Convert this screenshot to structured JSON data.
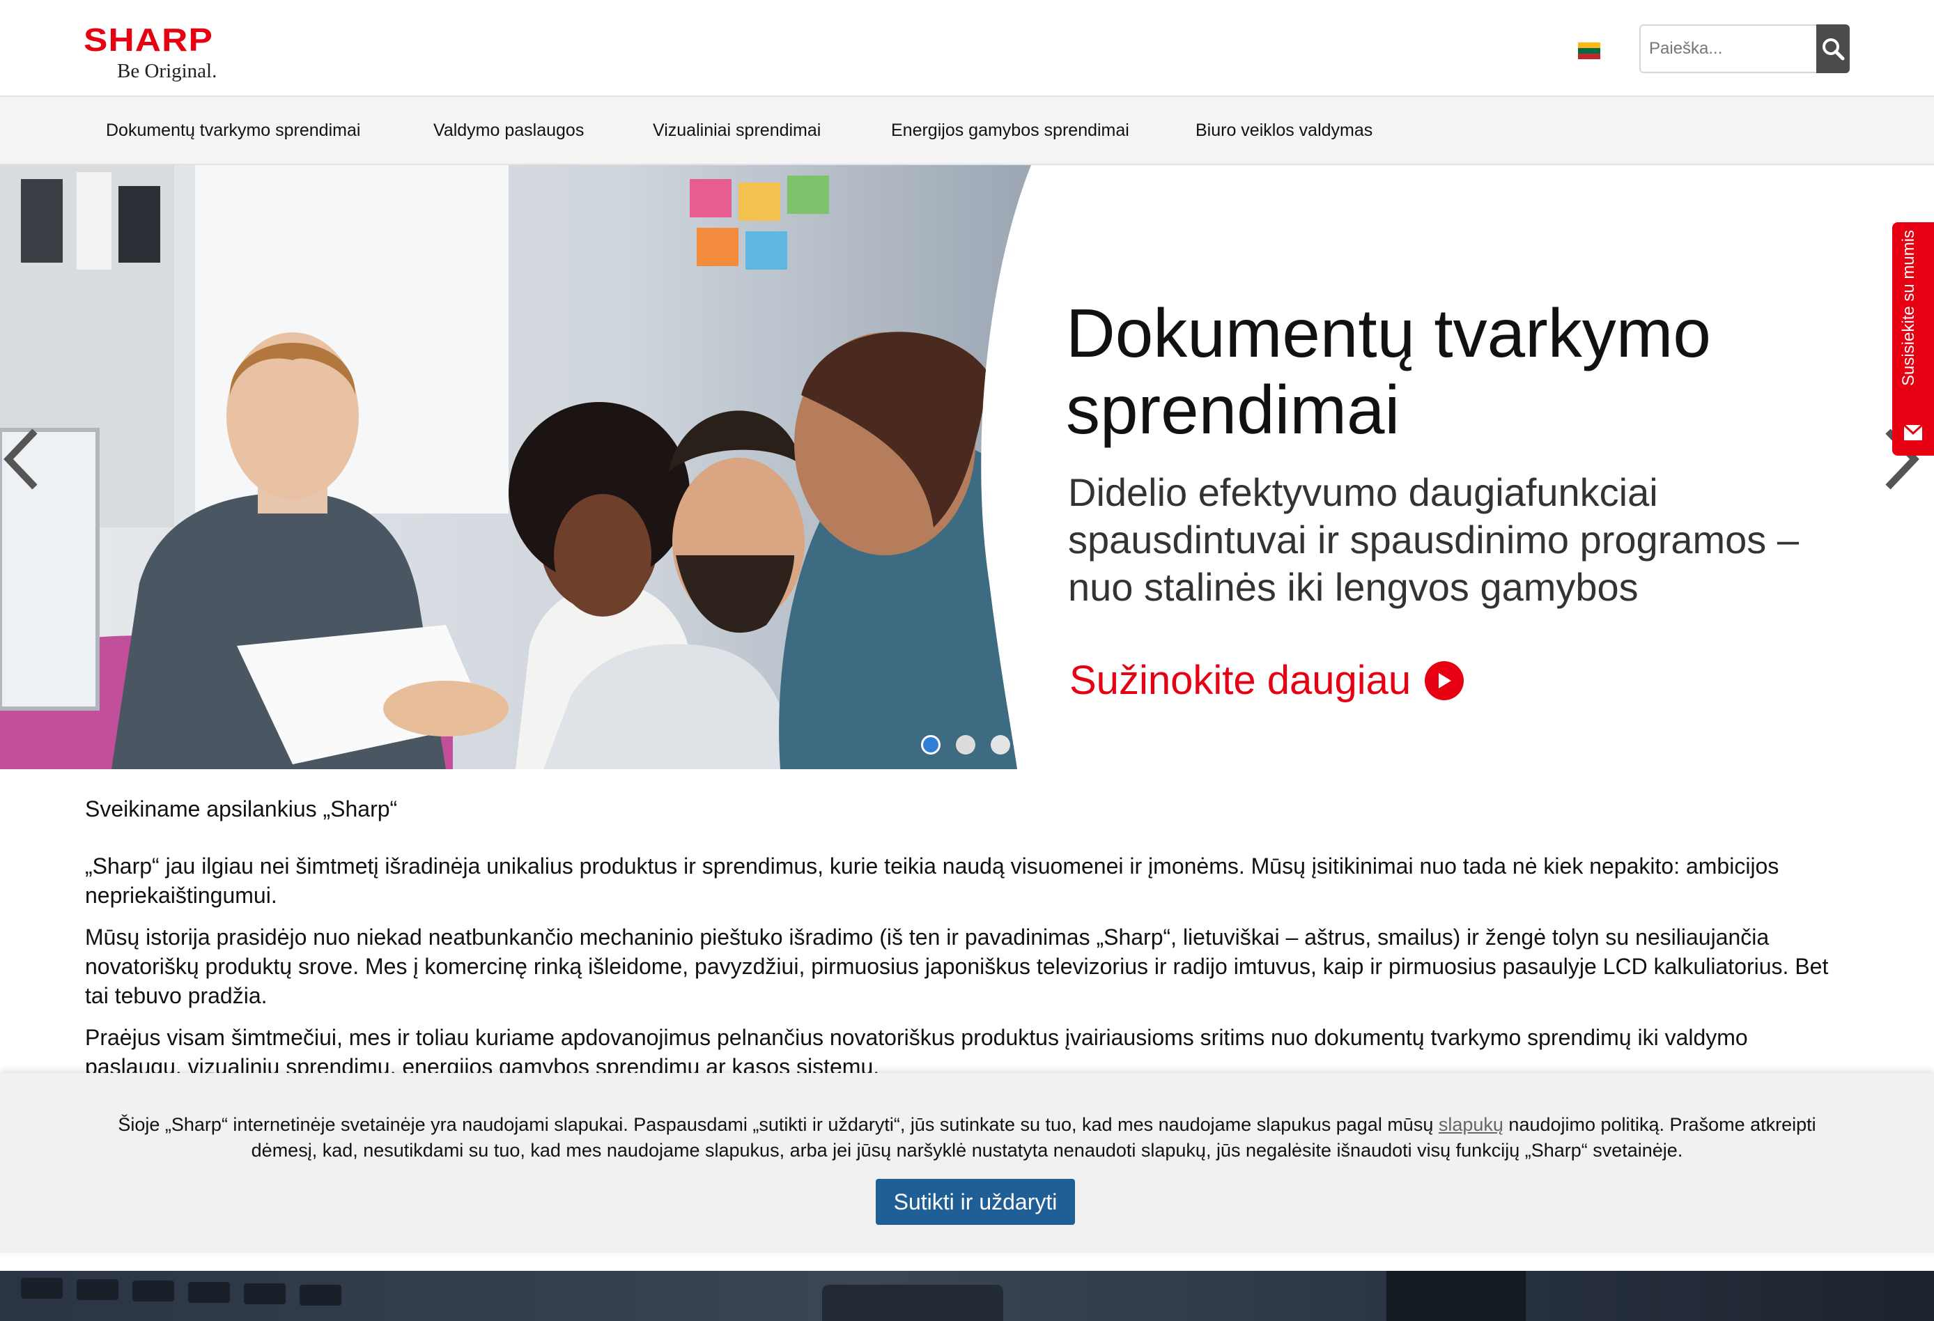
{
  "header": {
    "logo_word": "SHARP",
    "logo_tagline": "Be Original.",
    "language_flag": "lithuania-flag-icon",
    "search": {
      "placeholder": "Paieška...",
      "button_icon": "search-icon"
    }
  },
  "nav": {
    "items": [
      {
        "label": "Dokumentų tvarkymo sprendimai"
      },
      {
        "label": "Valdymo paslaugos"
      },
      {
        "label": "Vizualiniai sprendimai"
      },
      {
        "label": "Energijos gamybos sprendimai"
      },
      {
        "label": "Biuro veiklos valdymas"
      }
    ]
  },
  "hero": {
    "title": "Dokumentų tvarkymo sprendimai",
    "subtitle": "Didelio efektyvumo daugiafunkciai spausdintuvai ir spausdinimo programos – nuo stalinės iki lengvos gamybos",
    "cta_label": "Sužinokite daugiau",
    "slides_total": 3,
    "active_slide": 1
  },
  "contact_tab": {
    "label": "Susisiekite su mumis",
    "icon": "mail-icon"
  },
  "content": {
    "welcome": "Sveikiname apsilankius „Sharp“",
    "paragraphs": [
      "„Sharp“ jau ilgiau nei šimtmetį išradinėja unikalius produktus ir sprendimus, kurie teikia naudą visuomenei ir įmonėms. Mūsų įsitikinimai nuo tada nė kiek nepakito: ambicijos nepriekaištingumui.",
      "Mūsų istorija prasidėjo nuo niekad neatbunkančio mechaninio pieštuko išradimo (iš ten ir pavadinimas „Sharp“, lietuviškai – aštrus, smailus) ir žengė tolyn su nesiliaujančia novatoriškų produktų srove. Mes į komercinę rinką išleidome, pavyzdžiui, pirmuosius japoniškus televizorius ir radijo imtuvus, kaip ir pirmuosius pasaulyje LCD kalkuliatorius. Bet tai tebuvo pradžia.",
      "Praėjus visam šimtmečiui, mes ir toliau kuriame apdovanojimus pelnančius novatoriškus produktus įvairiausioms sritims nuo dokumentų tvarkymo sprendimų iki valdymo paslaugų, vizualinių sprendimų, energijos gamybos sprendimų ar kasos sistemų."
    ]
  },
  "cookie_banner": {
    "text_before_link": "Šioje „Sharp“ internetinėje svetainėje yra naudojami slapukai. Paspausdami „sutikti ir uždaryti“, jūs sutinkate su tuo, kad mes naudojame slapukus pagal mūsų ",
    "link_label": "slapukų",
    "text_after_link": " naudojimo politiką. Prašome atkreipti dėmesį, kad, nesutikdami su tuo, kad mes naudojame slapukus, arba jei jūsų naršyklė nustatyta nenaudoti slapukų, jūs negalėsite išnaudoti visų funkcijų „Sharp“ svetainėje.",
    "button_label": "Sutikti ir uždaryti"
  },
  "colors": {
    "brand_red": "#e60012",
    "cookie_button": "#1f5f95",
    "dot_active": "#2f7fd6",
    "nav_background": "#f4f4f4"
  }
}
